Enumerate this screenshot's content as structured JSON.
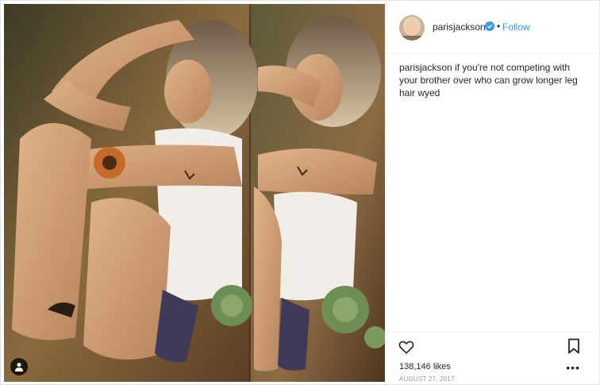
{
  "post": {
    "username": "parisjackson",
    "follow_label": "Follow",
    "separator": "•",
    "caption_user": "parisjackson",
    "caption_text": "if you're not competing with your brother over who can grow longer leg hair wyed",
    "likes": "138,146 likes",
    "date": "AUGUST 27, 2017",
    "more_label": "•••"
  },
  "colors": {
    "follow": "#3897f0",
    "verified": "#3897f0",
    "text": "#262626",
    "muted": "#999999"
  },
  "icons": {
    "verified": "verified-badge-icon",
    "like": "heart-icon",
    "save": "bookmark-icon",
    "tagged": "person-tag-icon",
    "more": "more-options-icon"
  }
}
